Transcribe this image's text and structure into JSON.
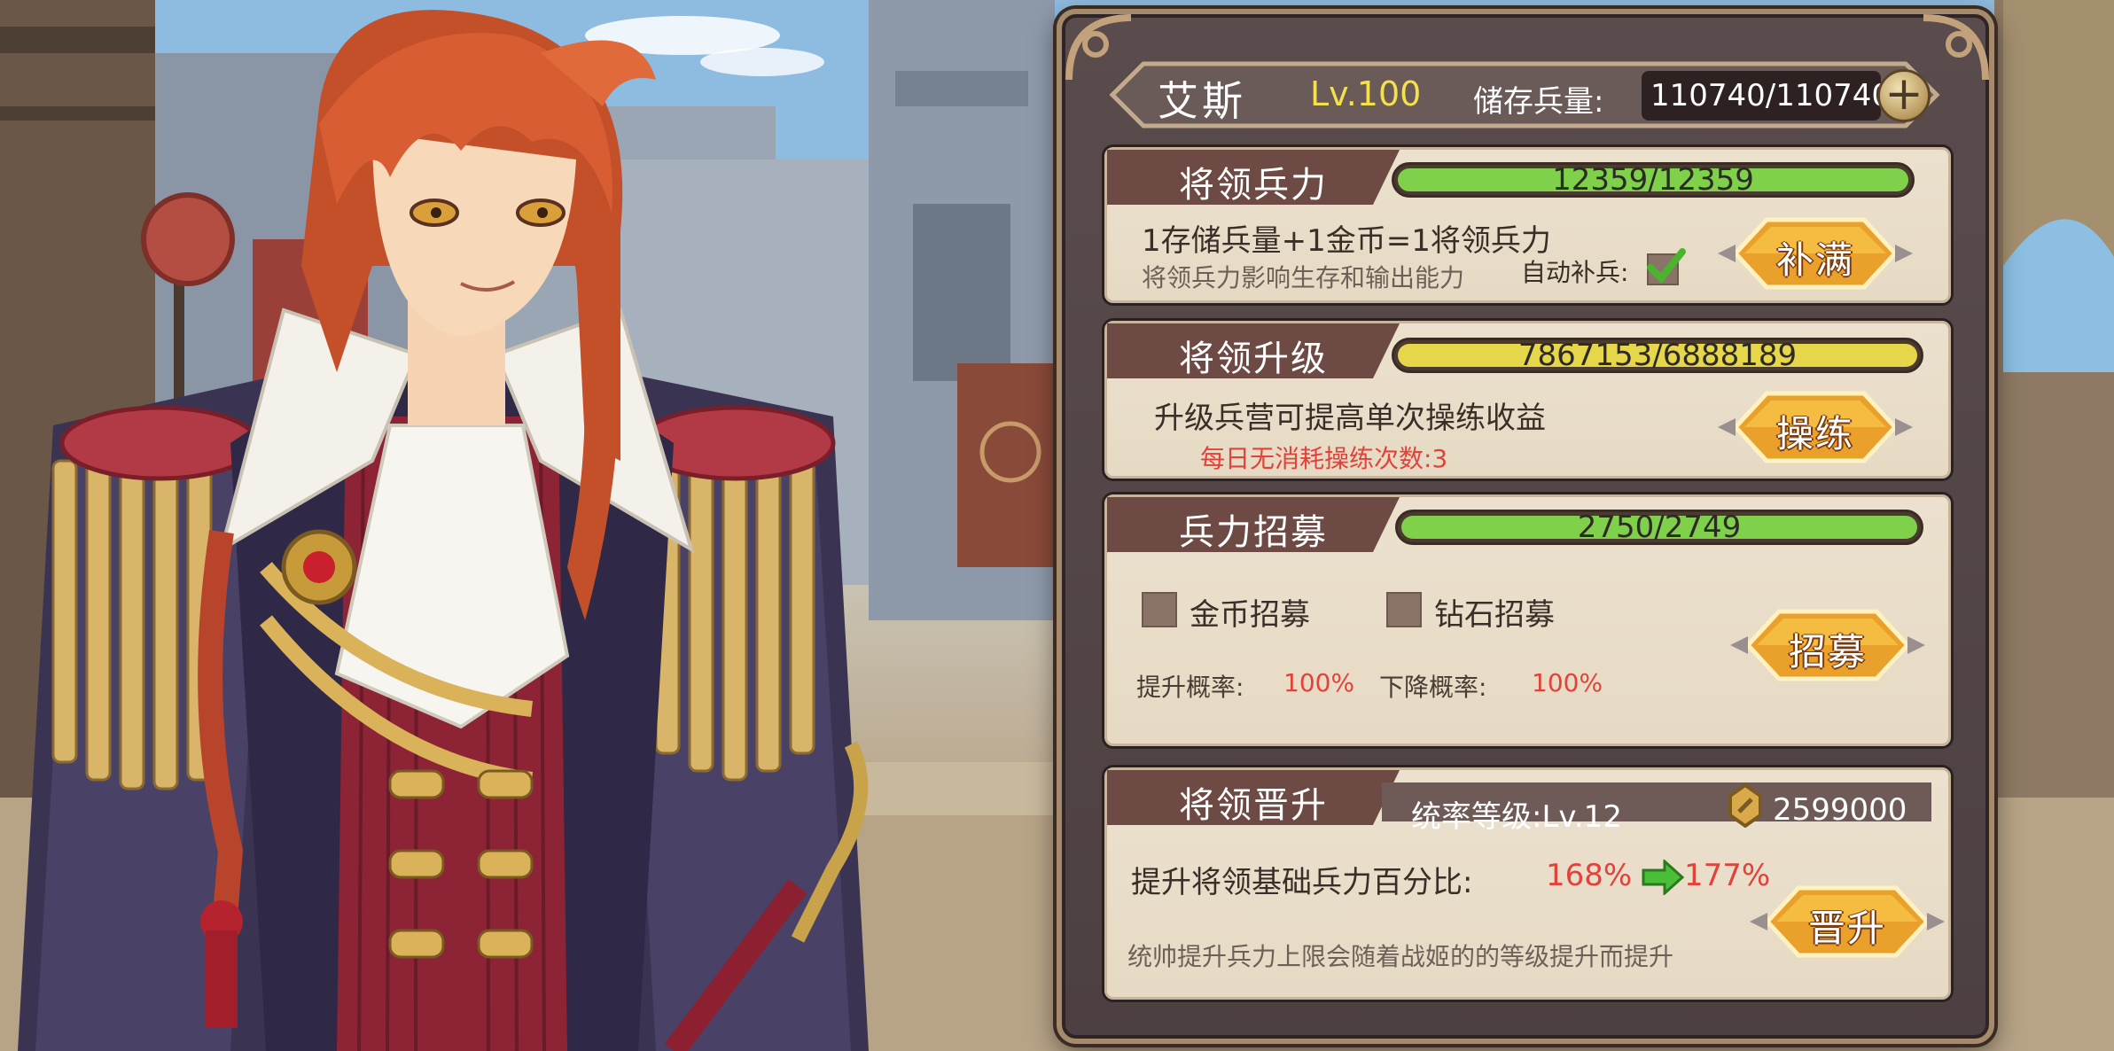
{
  "hero": {
    "name": "艾斯",
    "level": "Lv.100",
    "store_label": "储存兵量:",
    "store_value": "110740/110740",
    "plus": "+"
  },
  "sections": {
    "troops": {
      "title": "将领兵力",
      "bar_text": "12359/12359",
      "progress": 1.0,
      "formula": "1存储兵量+1金币=1将领兵力",
      "desc": "将领兵力影响生存和输出能力",
      "auto_label": "自动补兵:",
      "auto_checked": true,
      "button": "补满"
    },
    "upgrade": {
      "title": "将领升级",
      "bar_text": "7867153/6888189",
      "progress": 1.0,
      "desc": "升级兵营可提高单次操练收益",
      "daily": "每日无消耗操练次数:3",
      "button": "操练"
    },
    "recruit": {
      "title": "兵力招募",
      "bar_text": "2750/2749",
      "progress": 1.0,
      "opt_gold": "金币招募",
      "opt_diamond": "钻石招募",
      "up_label": "提升概率:",
      "up_value": "100%",
      "down_label": "下降概率:",
      "down_value": "100%",
      "button": "招募"
    },
    "promote": {
      "title": "将领晋升",
      "rank_label": "统率等级:Lv.12",
      "cost": "2599000",
      "pct_label": "提升将领基础兵力百分比:",
      "pct_from": "168%",
      "pct_to": "177%",
      "desc": "统帅提升兵力上限会随着战姬的的等级提升而提升",
      "button": "晋升"
    }
  },
  "colors": {
    "bar_green": "#7fd04a",
    "bar_yellow": "#e6d64a",
    "accent_red": "#e1433b",
    "level_yellow": "#f4e04a"
  }
}
